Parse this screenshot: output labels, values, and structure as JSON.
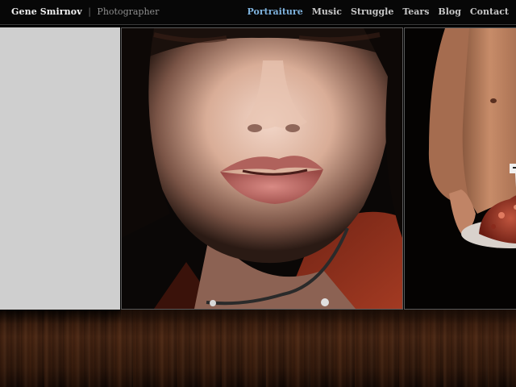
{
  "header": {
    "brand_name": "Gene Smirnov",
    "separator": "|",
    "brand_role": "Photographer"
  },
  "nav": {
    "items": [
      {
        "label": "Portraiture",
        "active": true
      },
      {
        "label": "Music",
        "active": false
      },
      {
        "label": "Struggle",
        "active": false
      },
      {
        "label": "Tears",
        "active": false
      },
      {
        "label": "Blog",
        "active": false
      },
      {
        "label": "Contact",
        "active": false
      }
    ]
  },
  "colors": {
    "nav_active": "#7fb3de",
    "nav_default": "#c7c7c7",
    "header_bg": "#070707",
    "placeholder_bg": "#cfcfcf",
    "floor": "#3f2111"
  }
}
